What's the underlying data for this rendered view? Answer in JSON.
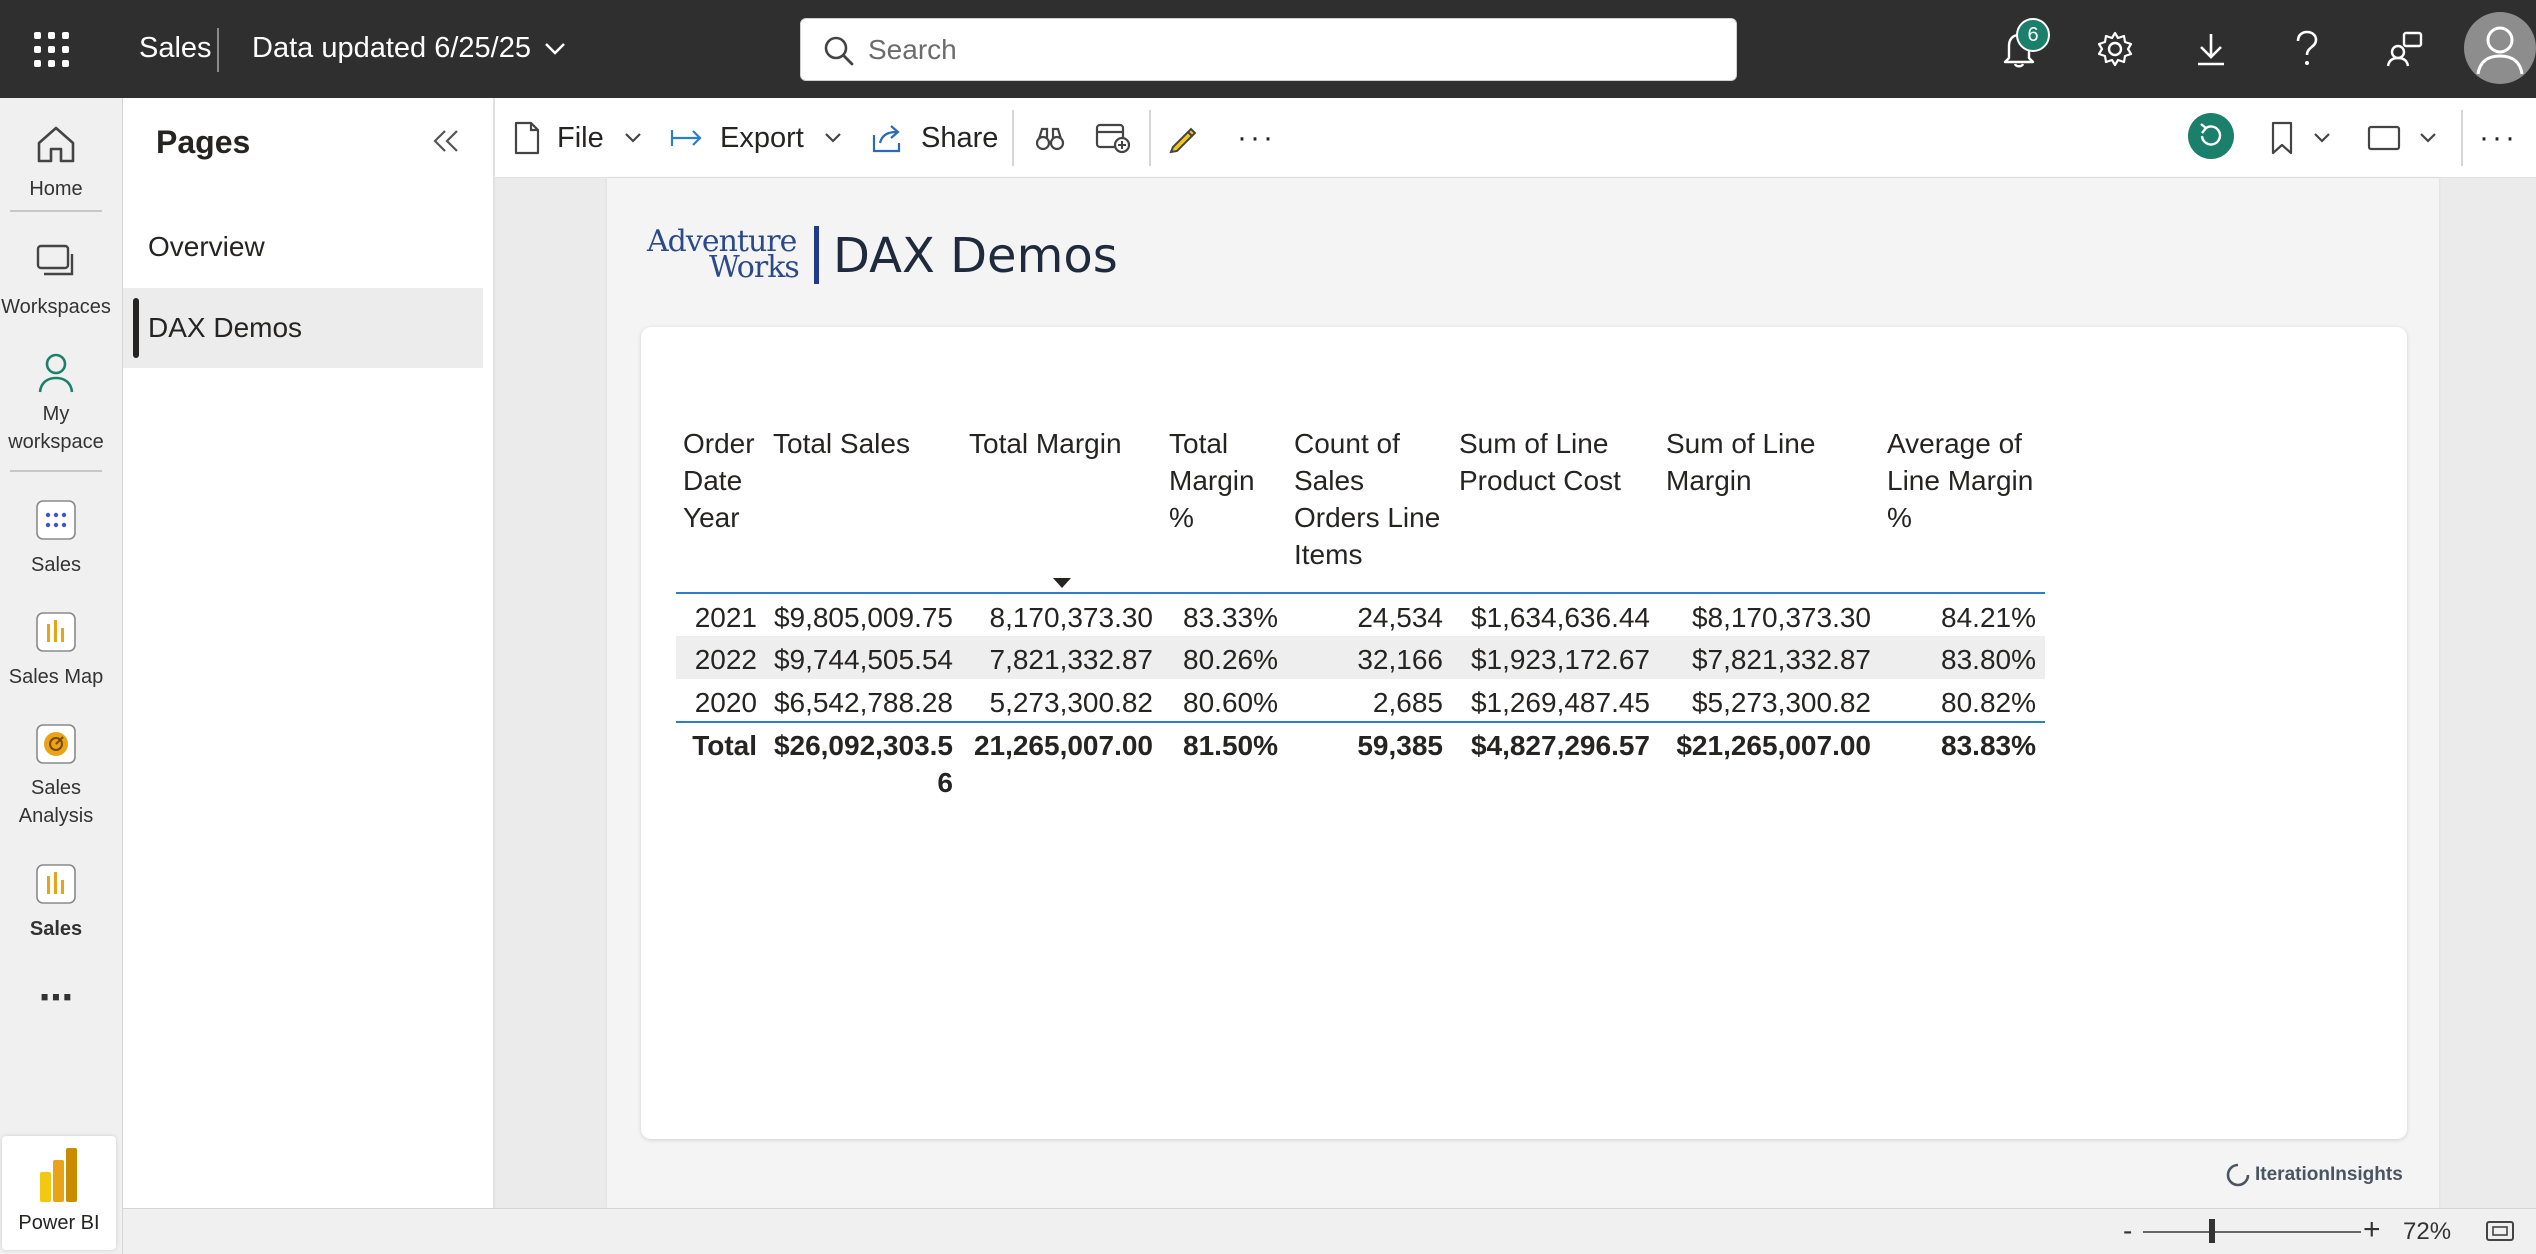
{
  "header": {
    "app_name": "Sales",
    "data_updated": "Data updated 6/25/25",
    "search_placeholder": "Search",
    "notification_count": "6"
  },
  "leftnav": {
    "items": [
      {
        "label": "Home",
        "icon": "home-icon"
      },
      {
        "label": "Workspaces",
        "icon": "workspaces-icon"
      },
      {
        "label": "My workspace",
        "icon": "person-icon"
      },
      {
        "label": "Sales",
        "icon": "app-icon"
      },
      {
        "label": "Sales Map",
        "icon": "report-icon"
      },
      {
        "label": "Sales Analysis",
        "icon": "dashboard-icon"
      },
      {
        "label": "Sales",
        "icon": "report-icon"
      }
    ],
    "more_label": "⋯",
    "brand_label": "Power BI"
  },
  "pages": {
    "title": "Pages",
    "items": [
      {
        "label": "Overview",
        "active": false
      },
      {
        "label": "DAX Demos",
        "active": true
      }
    ]
  },
  "toolbar": {
    "file_label": "File",
    "export_label": "Export",
    "share_label": "Share"
  },
  "report": {
    "logo_line1": "Adventure",
    "logo_line2": "Works",
    "title": "DAX Demos",
    "credit": "IterationInsights"
  },
  "chart_data": {
    "type": "table",
    "columns": [
      "Order Date Year",
      "Total Sales",
      "Total Margin",
      "Total Margin %",
      "Count of Sales Orders Line Items",
      "Sum of Line Product Cost",
      "Sum of Line Margin",
      "Average of Line Margin %"
    ],
    "sorted_column": "Total Margin",
    "sort_direction": "descending",
    "rows": [
      [
        "2021",
        "$9,805,009.75",
        "8,170,373.30",
        "83.33%",
        "24,534",
        "$1,634,636.44",
        "$8,170,373.30",
        "84.21%"
      ],
      [
        "2022",
        "$9,744,505.54",
        "7,821,332.87",
        "80.26%",
        "32,166",
        "$1,923,172.67",
        "$7,821,332.87",
        "83.80%"
      ],
      [
        "2020",
        "$6,542,788.28",
        "5,273,300.82",
        "80.60%",
        "2,685",
        "$1,269,487.45",
        "$5,273,300.82",
        "80.82%"
      ]
    ],
    "total": [
      "Total",
      "$26,092,303.56",
      "21,265,007.00",
      "81.50%",
      "59,385",
      "$4,827,296.57",
      "$21,265,007.00",
      "83.83%"
    ]
  },
  "footer": {
    "zoom_minus": "-",
    "zoom_plus": "+",
    "zoom_level": "72%"
  },
  "colors": {
    "topbar": "#2f2f2f",
    "accent_teal": "#1a7f6b",
    "table_rule": "#2a7fc8",
    "powerbi_yellow": "#f2c811"
  }
}
